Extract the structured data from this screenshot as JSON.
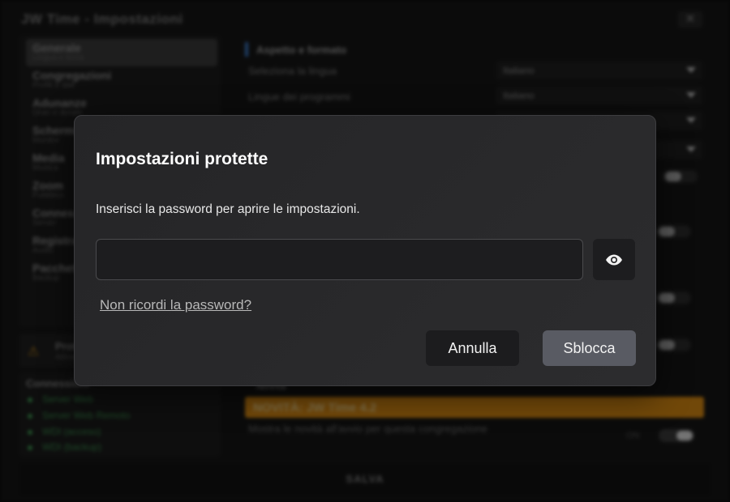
{
  "app": {
    "title": "JW Time - Impostazioni",
    "close_glyph": "✕",
    "sidebar": {
      "items": [
        {
          "title": "Generale",
          "subtitle": "Lingua e tema"
        },
        {
          "title": "Congregazioni",
          "subtitle": "Profili e dati"
        },
        {
          "title": "Adunanze",
          "subtitle": "Orari e durate"
        },
        {
          "title": "Schermi",
          "subtitle": "Monitor"
        },
        {
          "title": "Media",
          "subtitle": "Musica"
        },
        {
          "title": "Zoom",
          "subtitle": "Pubblico"
        },
        {
          "title": "Connessioni",
          "subtitle": "Server"
        },
        {
          "title": "Registrazione",
          "subtitle": "Audio"
        },
        {
          "title": "Pacchetti",
          "subtitle": "Backup"
        }
      ]
    },
    "warning": {
      "icon": "warning-triangle-icon",
      "title": "Protezione",
      "subtitle": "Attiva"
    },
    "connections": {
      "heading": "Connessioni",
      "items": [
        "Server Web",
        "Server Web Remoto",
        "WDI (acceso)",
        "WDI (backup)"
      ]
    },
    "main": {
      "section_title": "Aspetto e formato",
      "language_label": "Seleziona la lingua",
      "language_value": "Italiano",
      "program_language_label": "Lingue dei programmi",
      "program_language_value": "Italiano",
      "news_heading": "Novità",
      "news_banner": "NOVITÀ: JW Time 4.2",
      "news_row_label": "Mostra le novità all'avvio per questa congregazione",
      "news_toggle_state": "ON"
    },
    "save_label": "SALVA"
  },
  "modal": {
    "title": "Impostazioni protette",
    "description": "Inserisci la password per aprire le impostazioni.",
    "password_value": "",
    "password_placeholder": "",
    "eye_icon": "eye-icon",
    "forgot_link": "Non ricordi la password?",
    "cancel_label": "Annulla",
    "unlock_label": "Sblocca"
  },
  "colors": {
    "accent_blue": "#3d79c7",
    "banner_orange": "#d98a13",
    "unlock_button": "#595b63",
    "modal_bg": "#2a2a2c"
  }
}
